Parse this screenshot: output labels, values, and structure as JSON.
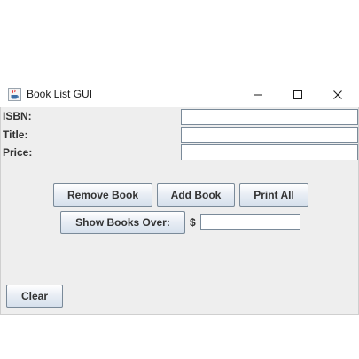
{
  "window": {
    "title": "Book List GUI",
    "icon": "java-coffee-cup-icon",
    "controls": {
      "minimize": "minimize-icon",
      "maximize": "maximize-icon",
      "close": "close-icon"
    }
  },
  "form": {
    "isbn_label": "ISBN:",
    "isbn_value": "",
    "title_label": "Title:",
    "title_value": "",
    "price_label": "Price:",
    "price_value": ""
  },
  "buttons": {
    "remove_book": "Remove Book",
    "add_book": "Add Book",
    "print_all": "Print All",
    "show_books_over": "Show Books Over:",
    "clear": "Clear"
  },
  "threshold": {
    "currency_symbol": "$",
    "value": ""
  },
  "colors": {
    "panel_background": "#eeeeee",
    "button_gradient_top": "#ffffff",
    "button_gradient_bottom": "#d6e0ec",
    "button_border": "#7a8a99",
    "field_border": "#7a8a99"
  }
}
